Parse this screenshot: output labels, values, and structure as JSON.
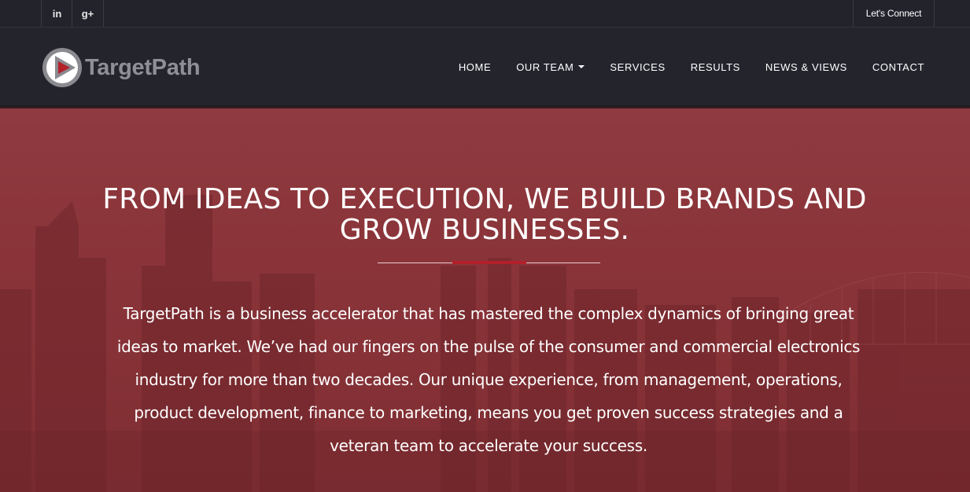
{
  "topbar": {
    "social": [
      {
        "icon": "linkedin-icon",
        "label": "in"
      },
      {
        "icon": "google-plus-icon",
        "label": "g+"
      }
    ],
    "connect_label": "Let's Connect"
  },
  "brand": {
    "name": "TargetPath",
    "logo_icon": "play-triangle-logo-icon"
  },
  "nav": {
    "items": [
      {
        "label": "HOME"
      },
      {
        "label": "OUR TEAM",
        "has_dropdown": true
      },
      {
        "label": "SERVICES"
      },
      {
        "label": "RESULTS"
      },
      {
        "label": "NEWS & VIEWS"
      },
      {
        "label": "CONTACT"
      }
    ]
  },
  "hero": {
    "headline_line1": "FROM IDEAS TO EXECUTION, WE BUILD BRANDS AND",
    "headline_line2": "GROW BUSINESSES.",
    "intro": "TargetPath is a business accelerator that has mastered the complex dynamics of bringing great ideas to market. We’ve had our fingers on the pulse of the consumer and commercial electronics industry for more than two decades. Our unique experience, from management, operations, product development, finance to marketing, means you get proven success strategies and a veteran team to accelerate your success.",
    "overlay_color": "#8a3439",
    "accent_color": "#b3202a"
  }
}
